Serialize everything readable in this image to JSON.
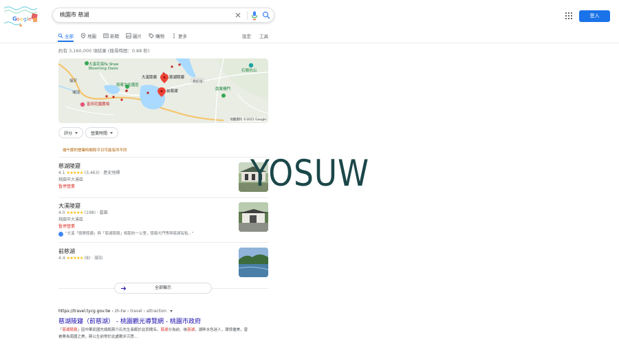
{
  "search": {
    "query": "桃園市 慈湖"
  },
  "header": {
    "signin_label": "登入",
    "icons": [
      "google-doodle-logo",
      "close-icon",
      "mic-icon",
      "search-icon",
      "apps-grid-icon"
    ]
  },
  "tabs": [
    {
      "label": "全部",
      "icon": "search-icon",
      "active": true
    },
    {
      "label": "地圖",
      "icon": "map-pin-icon"
    },
    {
      "label": "新聞",
      "icon": "news-icon"
    },
    {
      "label": "圖片",
      "icon": "image-icon"
    },
    {
      "label": "購物",
      "icon": "tag-icon"
    },
    {
      "label": "更多",
      "icon": "more-vert-icon"
    }
  ],
  "tools": {
    "settings_label": "設定",
    "tools_label": "工具"
  },
  "result_stats": "約有 3,160,000 項結果 (搜尋時間：0.88 秒)",
  "map": {
    "labels": {
      "oasis_zh": "大溪花海Ta Shee",
      "oasis_en": "Blooming Oasis",
      "cultural_park": "兩蔣文化園區",
      "mausoleum_small": "大溪陵寢",
      "cihu_mausoleum": "慈湖陵寢",
      "road": "國道3號",
      "front_lake": "前慈湖",
      "shitouwei": "石崗坑山",
      "nanhu_gate": "南翼柵門",
      "flower_farm": "富田花園農場",
      "village1": "福安",
      "village2": "埔頂"
    },
    "copyright": "地圖資料 ©2021 Google"
  },
  "chips": [
    {
      "label": "評分"
    },
    {
      "label": "營業時間"
    }
  ],
  "notice": "端午節的營業時間和平日可能有所不同",
  "places": [
    {
      "name": "慈湖陵寢",
      "rating": "4.1",
      "stars": "★★★★★",
      "reviews": "(3,463)",
      "category": "歷史地標",
      "address": "桃園市大溪區",
      "status": "暫停營業"
    },
    {
      "name": "大溪陵寢",
      "rating": "4.0",
      "stars": "★★★★★",
      "reviews": "(198)",
      "category": "墓園",
      "address": "桃園市大溪區",
      "status": "暫停營業",
      "review_snippet": "\"大溪「頭寮陵寢」與「慈湖陵寢」相距約一公里，陵寢大門等與慈湖有點...\""
    },
    {
      "name": "前慈湖",
      "rating": "4.4",
      "stars": "★★★★★",
      "reviews": "(8)",
      "category": "湖泊"
    }
  ],
  "show_all_label": "全部顯示",
  "organic": {
    "breadcrumb_host": "https://travel.tycg.gov.tw",
    "breadcrumb_path": " › zh-tw › travel › attraction",
    "title": "慈湖陵寢（前慈湖） - 桃園觀光導覽網 - 桃園市政府",
    "snippet_a": "「",
    "snippet_b": "慈湖陵寢",
    "snippet_c": "」因中華民國先總統蔣介石先生長眠於此而聞名。",
    "snippet_d": "慈湖",
    "snippet_e": "分為前、後",
    "snippet_f": "慈湖",
    "snippet_g": "，湖畔水色迷人，環境優美，曾被譽為南國之美，蔣公生前常於此處散步沉思..."
  },
  "watermark": "YOSUW",
  "colors": {
    "link": "#1a0dab",
    "accent": "#1a73e8",
    "closed_red": "#d93025",
    "star": "#fbbc04",
    "notice": "#b06000",
    "watermark": "#1b4749"
  }
}
